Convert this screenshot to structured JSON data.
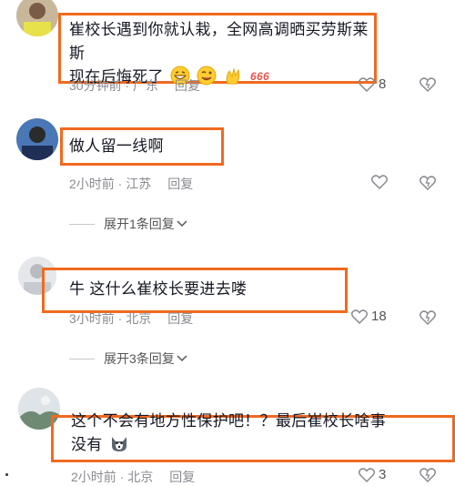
{
  "comments": [
    {
      "text_line1": "崔校长遇到你就认栽，全网高调晒买劳斯莱斯",
      "text_line2": "现在后悔死了",
      "time": "30分钟前 · 广东",
      "reply": "回复",
      "likes": "8",
      "emojis": [
        "grin-emoji",
        "wink-emoji",
        "clap-emoji",
        "666-emoji"
      ]
    },
    {
      "text": "做人留一线啊",
      "time": "2小时前 · 江苏",
      "reply": "回复",
      "likes": "",
      "expand": "展开1条回复"
    },
    {
      "text": "牛 这什么崔校长要进去喽",
      "time": "3小时前 · 北京",
      "reply": "回复",
      "likes": "18",
      "expand": "展开3条回复"
    },
    {
      "text_line1": "这个不会有地方性保护吧！？最后崔校长啥事",
      "text_line2": "没有",
      "time": "2小时前 · 北京",
      "reply": "回复",
      "likes": "3"
    }
  ],
  "colors": {
    "highlight": "#f06a1f",
    "meta": "#8a8b91",
    "text": "#161823"
  }
}
